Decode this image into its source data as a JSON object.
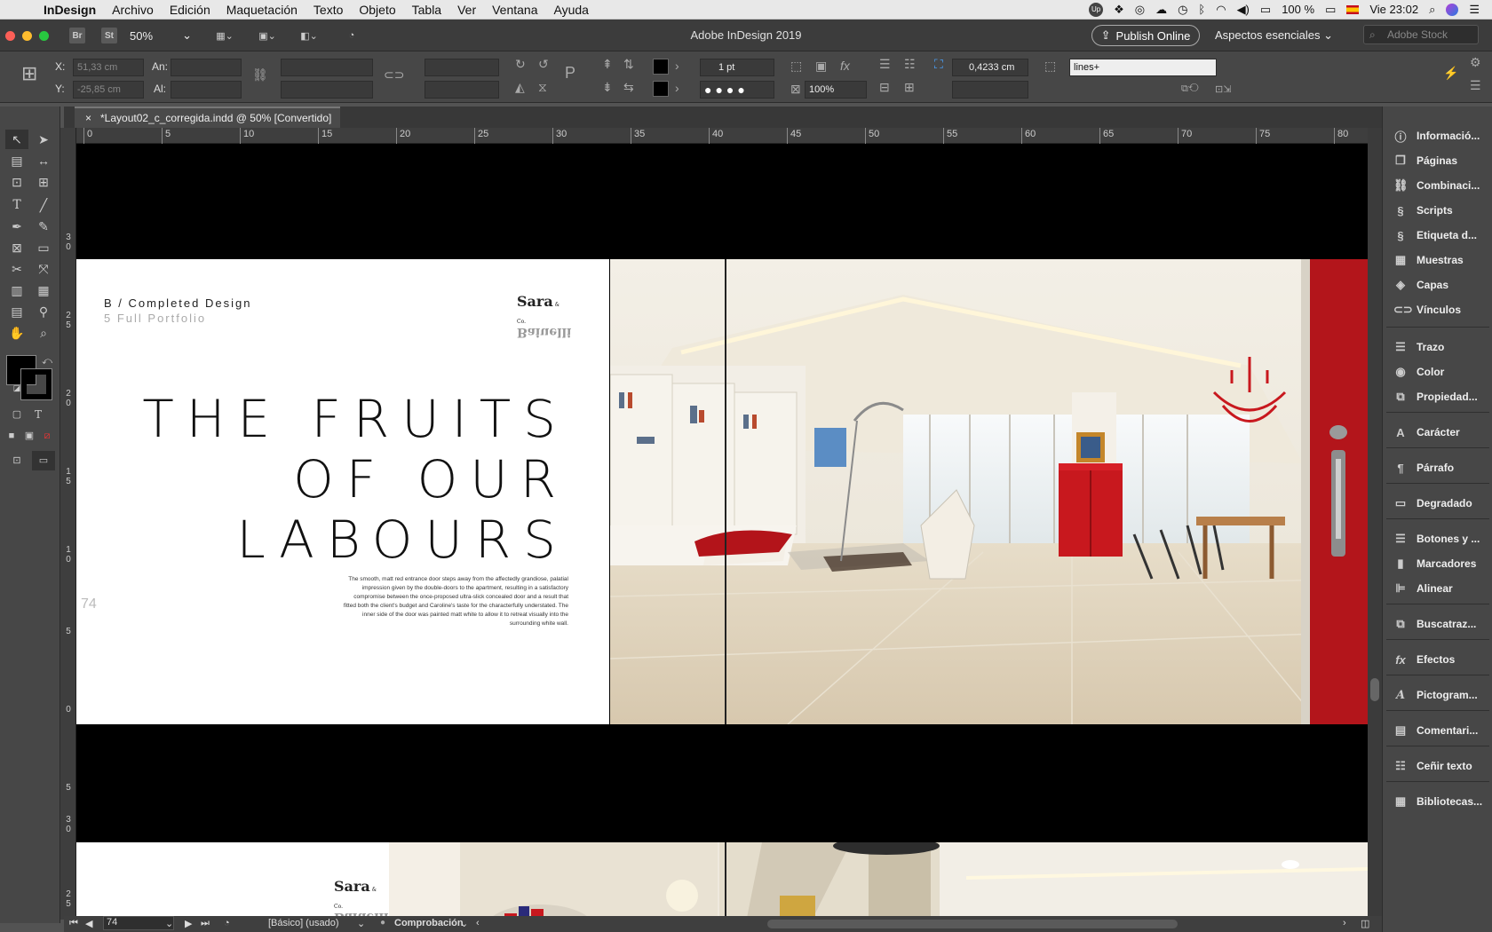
{
  "menubar": {
    "app": "InDesign",
    "items": [
      "Archivo",
      "Edición",
      "Maquetación",
      "Texto",
      "Objeto",
      "Tabla",
      "Ver",
      "Ventana",
      "Ayuda"
    ],
    "battery": "100 %",
    "clock": "Vie 23:02"
  },
  "titlebar": {
    "zoom": "50%",
    "app_title": "Adobe InDesign 2019",
    "publish": "Publish Online",
    "workspace": "Aspectos esenciales",
    "stock_placeholder": "Adobe Stock",
    "br": "Br",
    "st": "St"
  },
  "control": {
    "x_label": "X:",
    "x_value": "51,33 cm",
    "y_label": "Y:",
    "y_value": "-25,85 cm",
    "w_label": "An:",
    "h_label": "Al:",
    "stroke_weight": "1 pt",
    "opacity": "100%",
    "gap_value": "0,4233 cm",
    "object_style": "lines+"
  },
  "document": {
    "tab_title": "*Layout02_c_corregida.indd @ 50% [Convertido]"
  },
  "rulers": {
    "top": [
      "0",
      "5",
      "10",
      "15",
      "20",
      "25",
      "30",
      "35",
      "40",
      "45",
      "50",
      "55",
      "60",
      "65",
      "70",
      "75",
      "80"
    ],
    "left": [
      "3\n0",
      "2\n5",
      "2\n0",
      "1\n5",
      "1\n0",
      "5",
      "0",
      "5",
      "3\n0",
      "2\n5"
    ]
  },
  "spread": {
    "kicker": "B / Completed Design",
    "kicker_sub": "5 Full Portfolio",
    "logo_top": "Sara",
    "logo_small": "& Co.",
    "logo_bottom": "Baiuelli",
    "headline": [
      "THE FRUITS",
      "OF OUR",
      "LABOURS"
    ],
    "body": "The smooth, matt red entrance door steps away from the affectedly grandiose, palatial impression given by the double-doors to the apartment, resulting in a satisfactory compromise between the once-proposed ultra-slick concealed door and a result that fitted both the client's budget and Caroline's taste for the characterfully understated. The inner side of the door was painted matt white to allow it to retreat visually into the surrounding white wall.",
    "page_number": "74"
  },
  "panels": [
    "Informació...",
    "Páginas",
    "Combinaci...",
    "Scripts",
    "Etiqueta d...",
    "Muestras",
    "Capas",
    "Vínculos",
    "Trazo",
    "Color",
    "Propiedad...",
    "Carácter",
    "Párrafo",
    "Degradado",
    "Botones y ...",
    "Marcadores",
    "Alinear",
    "Buscatraz...",
    "Efectos",
    "Pictogram...",
    "Comentari...",
    "Ceñir texto",
    "Bibliotecas..."
  ],
  "status": {
    "page": "74",
    "style": "[Básico] (usado)",
    "preflight": "Comprobación"
  },
  "colors": {
    "accent_red": "#c8151b",
    "ui_dark": "#474747"
  }
}
